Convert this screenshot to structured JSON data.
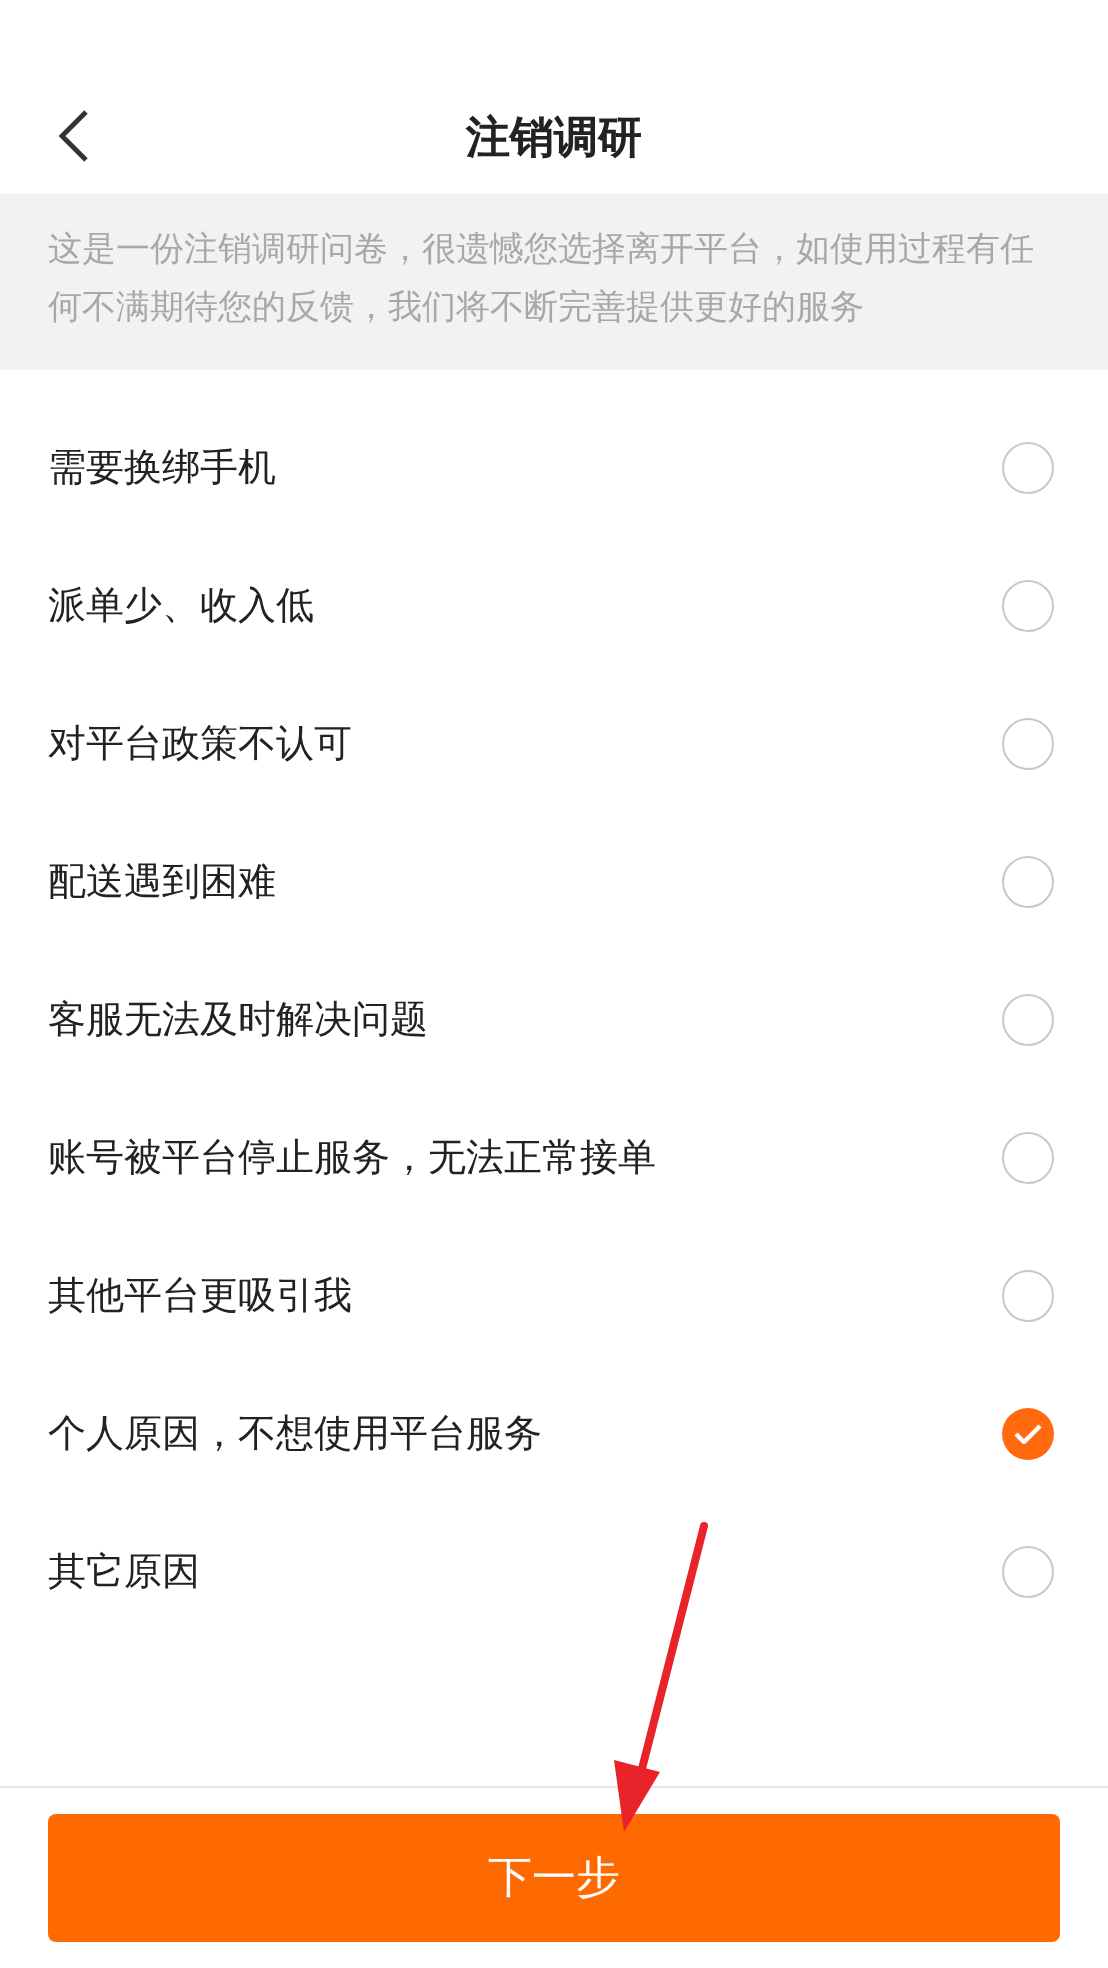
{
  "header": {
    "title": "注销调研"
  },
  "intro": "这是一份注销调研问卷，很遗憾您选择离开平台，如使用过程有任何不满期待您的反馈，我们将不断完善提供更好的服务",
  "options": [
    {
      "label": "需要换绑手机",
      "selected": false
    },
    {
      "label": "派单少、收入低",
      "selected": false
    },
    {
      "label": "对平台政策不认可",
      "selected": false
    },
    {
      "label": "配送遇到困难",
      "selected": false
    },
    {
      "label": "客服无法及时解决问题",
      "selected": false
    },
    {
      "label": "账号被平台停止服务，无法正常接单",
      "selected": false
    },
    {
      "label": "其他平台更吸引我",
      "selected": false
    },
    {
      "label": "个人原因，不想使用平台服务",
      "selected": true
    },
    {
      "label": "其它原因",
      "selected": false
    }
  ],
  "next_button": "下一步"
}
